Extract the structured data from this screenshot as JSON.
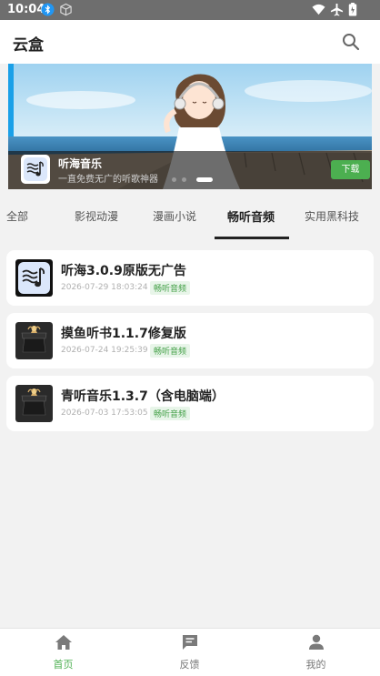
{
  "status_bar": {
    "time": "10:04"
  },
  "app_bar": {
    "title": "云盒",
    "search_icon": "search-icon"
  },
  "banner": {
    "app_name": "听海音乐",
    "subtitle": "一直免费无广的听歌神器",
    "download_label": "下载",
    "active_page": 3,
    "page_count": 3
  },
  "tabs": [
    {
      "label": "全部"
    },
    {
      "label": "影视动漫"
    },
    {
      "label": "漫画小说"
    },
    {
      "label": "畅听音频",
      "active": true
    },
    {
      "label": "实用黑科技"
    }
  ],
  "items": [
    {
      "name": "听海3.0.9原版无广告",
      "date": "2026-07-29 18:03:24",
      "tag": "畅听音频",
      "icon": "tinghai-music-icon"
    },
    {
      "name": "摸鱼听书1.1.7修复版",
      "date": "2026-07-24 19:25:39",
      "tag": "畅听音频",
      "icon": "gift-box-icon"
    },
    {
      "name": "青听音乐1.3.7（含电脑端）",
      "date": "2026-07-03 17:53:05",
      "tag": "畅听音频",
      "icon": "gift-box-icon"
    }
  ],
  "bottom_nav": [
    {
      "label": "首页",
      "icon": "home-icon",
      "active": true
    },
    {
      "label": "反馈",
      "icon": "feedback-icon"
    },
    {
      "label": "我的",
      "icon": "person-icon"
    }
  ],
  "colors": {
    "accent": "#4caf50",
    "status_bar": "#6e6e6e",
    "background": "#f2f2f2"
  }
}
